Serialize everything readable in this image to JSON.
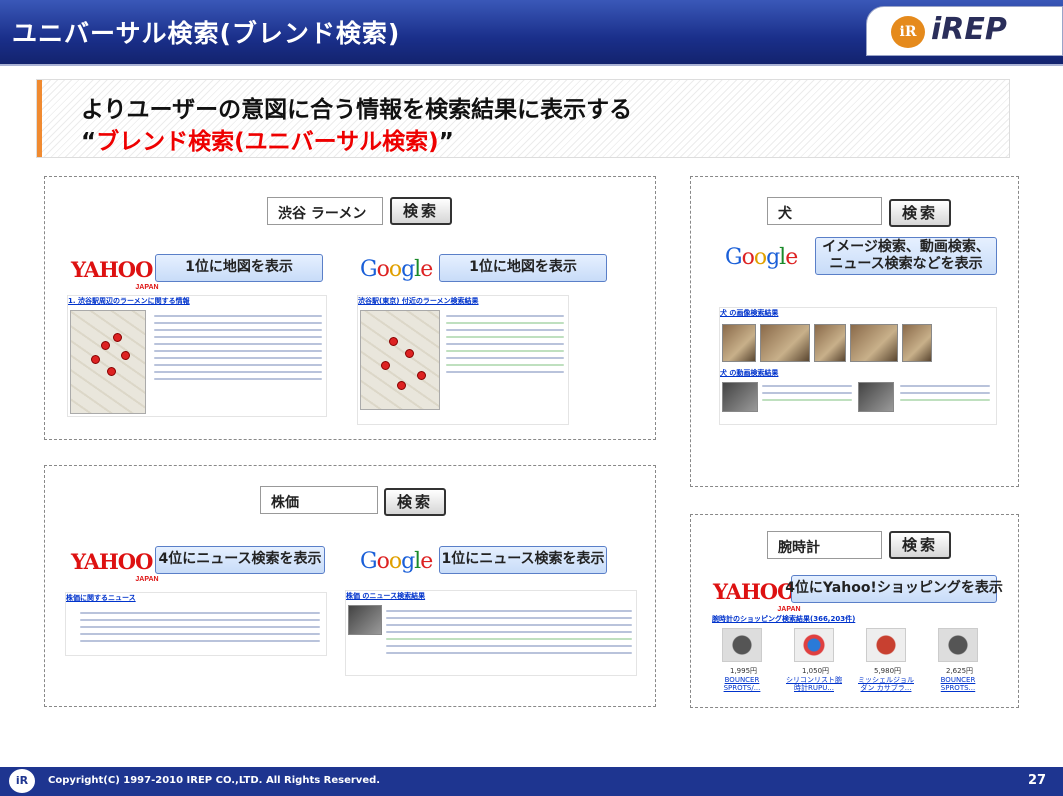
{
  "header": {
    "title": "ユニバーサル検索(ブレンド検索)",
    "logo_text": "iREP",
    "logo_mark": "iR"
  },
  "headline": {
    "line1": "よりユーザーの意図に合う情報を検索結果に表示する",
    "line2_prefix": "“",
    "line2_red": "ブレンド検索(ユニバーサル検索)",
    "line2_suffix": "”"
  },
  "panels": {
    "ramen": {
      "query": "渋谷 ラーメン",
      "button": "検索",
      "yahoo_logo": "YAHOO!",
      "yahoo_sub": "JAPAN",
      "yahoo_callout": "1位に地図を表示",
      "google_logo": "Google",
      "google_callout": "1位に地図を表示",
      "yahoo_snippet_title": "1. 渋谷駅周辺のラーメンに関する情報",
      "google_snippet_title": "渋谷駅(東京) 付近のラーメン検索結果"
    },
    "stock": {
      "query": "株価",
      "button": "検索",
      "yahoo_logo": "YAHOO!",
      "yahoo_sub": "JAPAN",
      "yahoo_callout": "4位にニュース検索を表示",
      "google_logo": "Google",
      "google_callout": "1位にニュース検索を表示",
      "yahoo_snippet_title": "株価に関するニュース",
      "google_snippet_title": "株価 のニュース検索結果"
    },
    "dog": {
      "query": "犬",
      "button": "検索",
      "google_logo": "Google",
      "callout_line1": "イメージ検索、動画検索、",
      "callout_line2": "ニュース検索などを表示",
      "image_title": "犬 の画像検索結果",
      "video_title": "犬 の動画検索結果"
    },
    "watch": {
      "query": "腕時計",
      "button": "検索",
      "yahoo_logo": "YAHOO!",
      "yahoo_sub": "JAPAN",
      "callout": "4位にYahoo!ショッピングを表示",
      "snippet_title": "腕時計のショッピング検索結果(366,203件)",
      "products": [
        {
          "price": "1,995円",
          "name": "BOUNCER SPROTS/..."
        },
        {
          "price": "1,050円",
          "name": "シリコンリスト腕時計RUPU..."
        },
        {
          "price": "5,980円",
          "name": "ミッシェルジョルダン カサブラ..."
        },
        {
          "price": "2,625円",
          "name": "BOUNCER SPROTS..."
        }
      ]
    }
  },
  "footer": {
    "copyright": "Copyright(C) 1997-2010 IREP CO.,LTD. All Rights Reserved.",
    "page": "27"
  }
}
